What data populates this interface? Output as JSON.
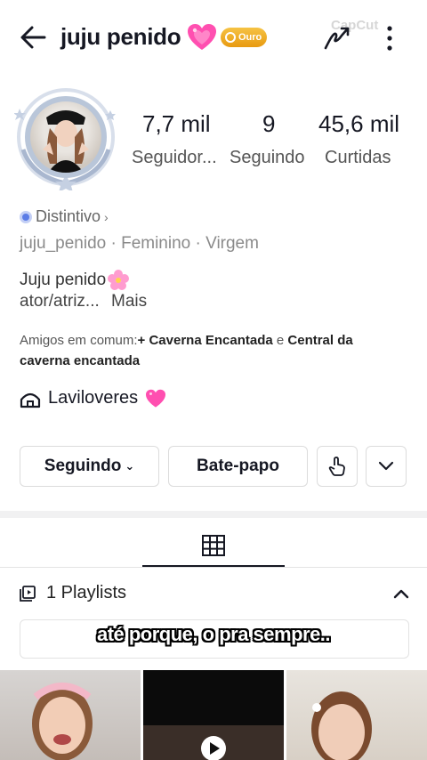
{
  "header": {
    "username": "juju penido",
    "badge_label": "Ouro",
    "watermark": "CapCut",
    "back_icon": "arrow-left-icon",
    "menu_icon": "more-vertical-icon",
    "heart_color": "#ff3fa4"
  },
  "stats": [
    {
      "value": "7,7 mil",
      "label": "Seguidor..."
    },
    {
      "value": "9",
      "label": "Seguindo"
    },
    {
      "value": "45,6 mil",
      "label": "Curtidas"
    }
  ],
  "profile": {
    "distintivo": "Distintivo",
    "meta": "juju_penido · Feminino · Virgem",
    "bio_line1": "Juju penido",
    "bio_line2_prefix": "ator/atriz...",
    "bio_more": "Mais",
    "mutual_prefix": "Amigos em comum:",
    "mutual_friend1": "+ Caverna Encantada",
    "mutual_and": " e ",
    "mutual_friend2": "Central da caverna encantada",
    "group_name": "Laviloveres"
  },
  "actions": {
    "following_label": "Seguindo",
    "chat_label": "Bate-papo"
  },
  "tabs": {
    "grid_icon": "grid-icon"
  },
  "playlists": {
    "label": "1 Playlists"
  },
  "subtitle": "até porque, o pra sempre..",
  "colors": {
    "badge_gold": "#f0ad26",
    "distintivo_blue": "#5b7ce6"
  }
}
